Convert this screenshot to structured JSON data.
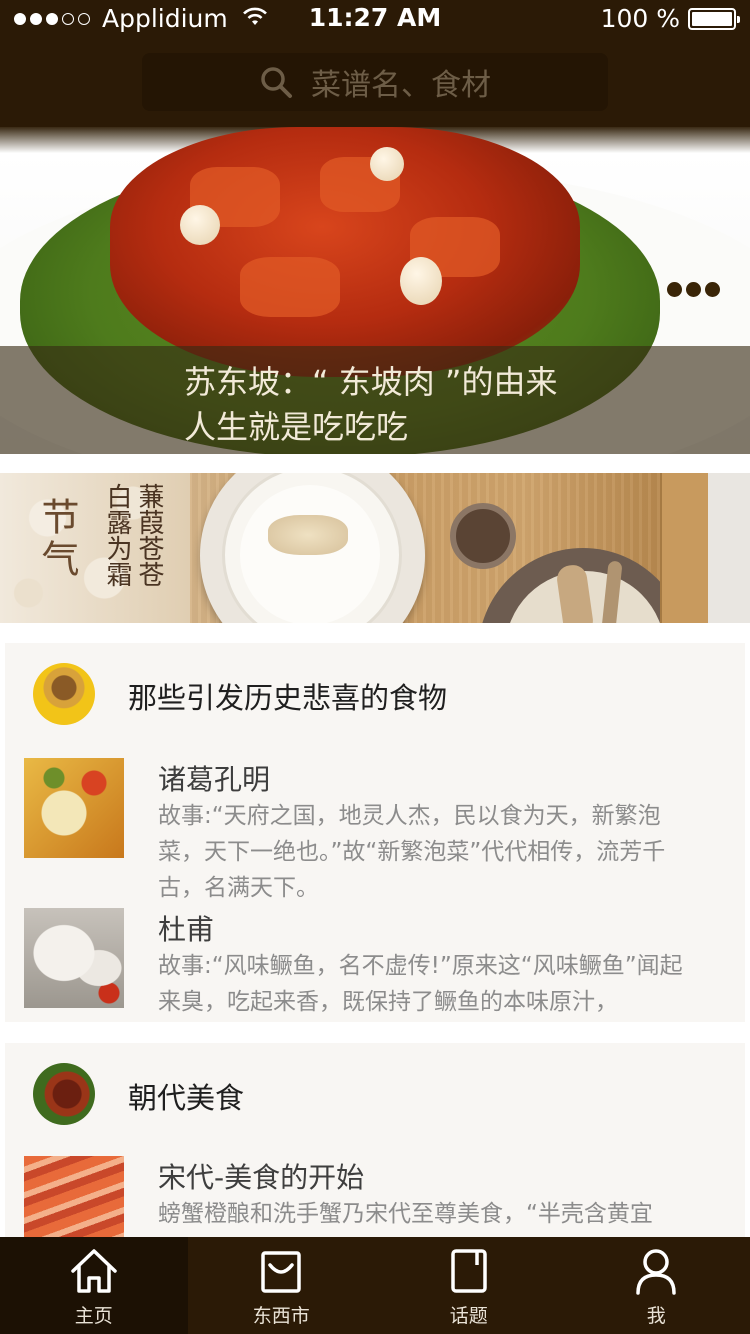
{
  "status_bar": {
    "carrier": "Applidium",
    "time": "11:27 AM",
    "battery": "100 %",
    "signal_bars_filled": 3,
    "signal_bars_total": 5
  },
  "search": {
    "placeholder": "菜谱名、食材",
    "icon": "search-icon"
  },
  "hero": {
    "caption_line1": "苏东坡：“ 东坡肉 ”的由来",
    "caption_line2": "人生就是吃吃吃",
    "pager_dots": 3
  },
  "banner": {
    "jieqi": "节气",
    "line_a": "白露为霜",
    "line_b": "蒹葭苍苍"
  },
  "sections": [
    {
      "title": "那些引发历史悲喜的食物",
      "items": [
        {
          "title": "诸葛孔明",
          "desc": "故事:“天府之国，地灵人杰，民以食为天，新繁泡菜，天下一绝也。”故“新繁泡菜”代代相传，流芳千古，名满天下。"
        },
        {
          "title": "杜甫",
          "desc": "故事:“风味鳜鱼，名不虚传!”原来这“风味鳜鱼”闻起来臭，吃起来香，既保持了鳜鱼的本味原汁，"
        }
      ]
    },
    {
      "title": "朝代美食",
      "items": [
        {
          "title": "宋代-美食的开始",
          "desc": "螃蟹橙酿和洗手蟹乃宋代至尊美食，“半壳含黄宜"
        }
      ]
    }
  ],
  "tabbar": {
    "items": [
      {
        "label": "主页",
        "icon": "home-icon",
        "active": true
      },
      {
        "label": "东西市",
        "icon": "bag-icon",
        "active": false
      },
      {
        "label": "话题",
        "icon": "topic-icon",
        "active": false
      },
      {
        "label": "我",
        "icon": "user-icon",
        "active": false
      }
    ]
  },
  "colors": {
    "top_bar": "#2b1a06",
    "tab_bar": "#2b1a06",
    "search_bg": "#241504",
    "section_bg": "#f8f6f3"
  }
}
